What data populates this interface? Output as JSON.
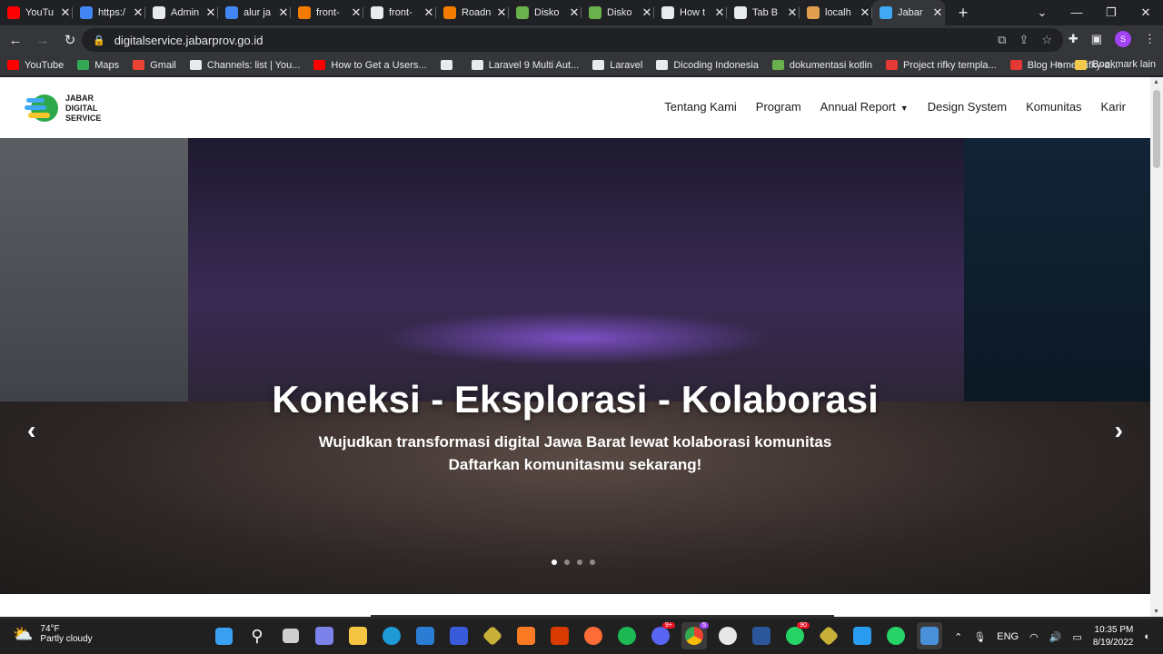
{
  "browser": {
    "tabs": [
      {
        "title": "YouTu",
        "color": "#ff0000",
        "active": false
      },
      {
        "title": "https:/",
        "color": "#4285f4",
        "active": false
      },
      {
        "title": "Admin",
        "color": "#e8eaed",
        "active": false
      },
      {
        "title": "alur ja",
        "color": "#4285f4",
        "active": false
      },
      {
        "title": "front-",
        "color": "#f57c00",
        "active": false
      },
      {
        "title": "front-",
        "color": "#e8eaed",
        "active": false
      },
      {
        "title": "Roadn",
        "color": "#f57c00",
        "active": false
      },
      {
        "title": "Disko",
        "color": "#6ab04c",
        "active": false
      },
      {
        "title": "Disko",
        "color": "#6ab04c",
        "active": false
      },
      {
        "title": "How t",
        "color": "#e8eaed",
        "active": false
      },
      {
        "title": "Tab B",
        "color": "#e8eaed",
        "active": false
      },
      {
        "title": "localh",
        "color": "#e0a050",
        "active": false
      },
      {
        "title": "Jabar",
        "color": "#3fa9f5",
        "active": true
      }
    ],
    "url": "digitalservice.jabarprov.go.id",
    "profile_initial": "S",
    "bookmarks": [
      {
        "label": "YouTube",
        "color": "#ff0000"
      },
      {
        "label": "Maps",
        "color": "#34a853"
      },
      {
        "label": "Gmail",
        "color": "#ea4335"
      },
      {
        "label": "Channels: list  |  You...",
        "color": "#e8eaed"
      },
      {
        "label": "How to Get a Users...",
        "color": "#ff0000"
      },
      {
        "label": "",
        "color": "#e8eaed"
      },
      {
        "label": "Laravel 9 Multi Aut...",
        "color": "#e8eaed"
      },
      {
        "label": "Laravel",
        "color": "#e8eaed"
      },
      {
        "label": "Dicoding Indonesia",
        "color": "#e8eaed"
      },
      {
        "label": "dokumentasi kotlin",
        "color": "#6ab04c"
      },
      {
        "label": "Project rifky templa...",
        "color": "#e53935"
      },
      {
        "label": "Blog Home -rifky-a...",
        "color": "#e53935"
      }
    ],
    "bookmarks_overflow": "»",
    "bookmarks_other": "Bookmark lain"
  },
  "site": {
    "logo_line1": "JABAR",
    "logo_line2": "DIGITAL",
    "logo_line3": "SERVICE",
    "nav": {
      "tentang": "Tentang Kami",
      "program": "Program",
      "annual": "Annual Report",
      "design": "Design System",
      "komunitas": "Komunitas",
      "karir": "Karir"
    },
    "hero": {
      "title": "Koneksi - Eksplorasi - Kolaborasi",
      "sub1": "Wujudkan transformasi digital Jawa Barat lewat kolaborasi komunitas",
      "sub2": "Daftarkan komunitasmu sekarang!",
      "slides": 4,
      "active_slide": 1
    }
  },
  "taskbar": {
    "temp": "74°F",
    "weather": "Partly cloudy",
    "lang": "ENG",
    "time": "10:35 PM",
    "date": "8/19/2022",
    "badge_discord": "9+",
    "badge_chrome": "5",
    "badge_whatsapp": "90"
  }
}
